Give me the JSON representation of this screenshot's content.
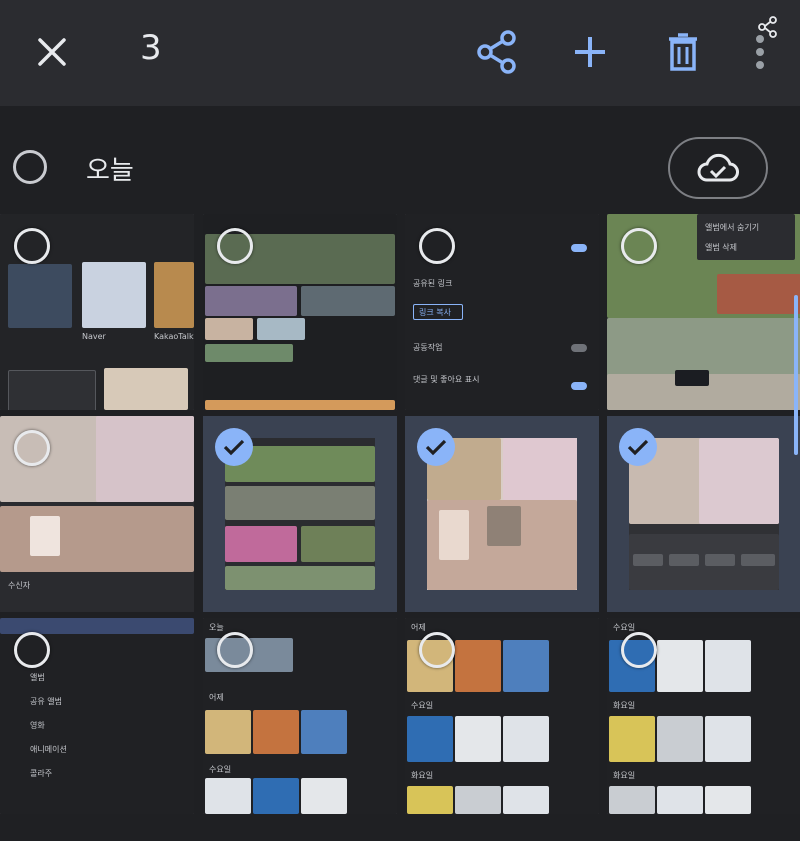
{
  "topbar": {
    "close_icon": "close-icon",
    "selected_count": "3",
    "actions": [
      "share-icon",
      "add-icon",
      "delete-icon",
      "more-vert-icon"
    ]
  },
  "section": {
    "date_label": "오늘",
    "backup_icon": "cloud-done-icon"
  },
  "tiles": [
    {
      "id": "t1",
      "selected": false
    },
    {
      "id": "t2",
      "selected": false
    },
    {
      "id": "t3",
      "selected": false
    },
    {
      "id": "t4",
      "selected": false
    },
    {
      "id": "t5",
      "selected": false
    },
    {
      "id": "t6",
      "selected": true
    },
    {
      "id": "t7",
      "selected": true
    },
    {
      "id": "t8",
      "selected": true
    },
    {
      "id": "t9",
      "selected": false
    },
    {
      "id": "t10",
      "selected": false
    },
    {
      "id": "t11",
      "selected": false
    },
    {
      "id": "t12",
      "selected": false
    }
  ],
  "tile_text": {
    "t1_apps": [
      "Naver",
      "KakaoTalk"
    ],
    "t3_share_link": "공유된 링크",
    "t3_link_copy": "링크 복사",
    "t3_allow_add": "공동작업",
    "t3_comments": "댓글 및 좋아요 표시",
    "t4_menu_1": "앨범에서 숨기기",
    "t4_menu_2": "앨범 삭제",
    "t5_caption": "수신자",
    "t9_menu": [
      "앨범",
      "공유 앨범",
      "영화",
      "애니메이션",
      "콜라주"
    ],
    "t10_labels": [
      "오늘",
      "어제",
      "수요일"
    ],
    "t11_labels": [
      "어제",
      "수요일",
      "화요일"
    ],
    "t12_labels": [
      "수요일",
      "화요일",
      "화요일"
    ]
  },
  "colors": {
    "accent": "#8ab4f8",
    "background": "#1f2023",
    "topbar": "#2b2c30",
    "selected_tile": "#3a4252"
  }
}
